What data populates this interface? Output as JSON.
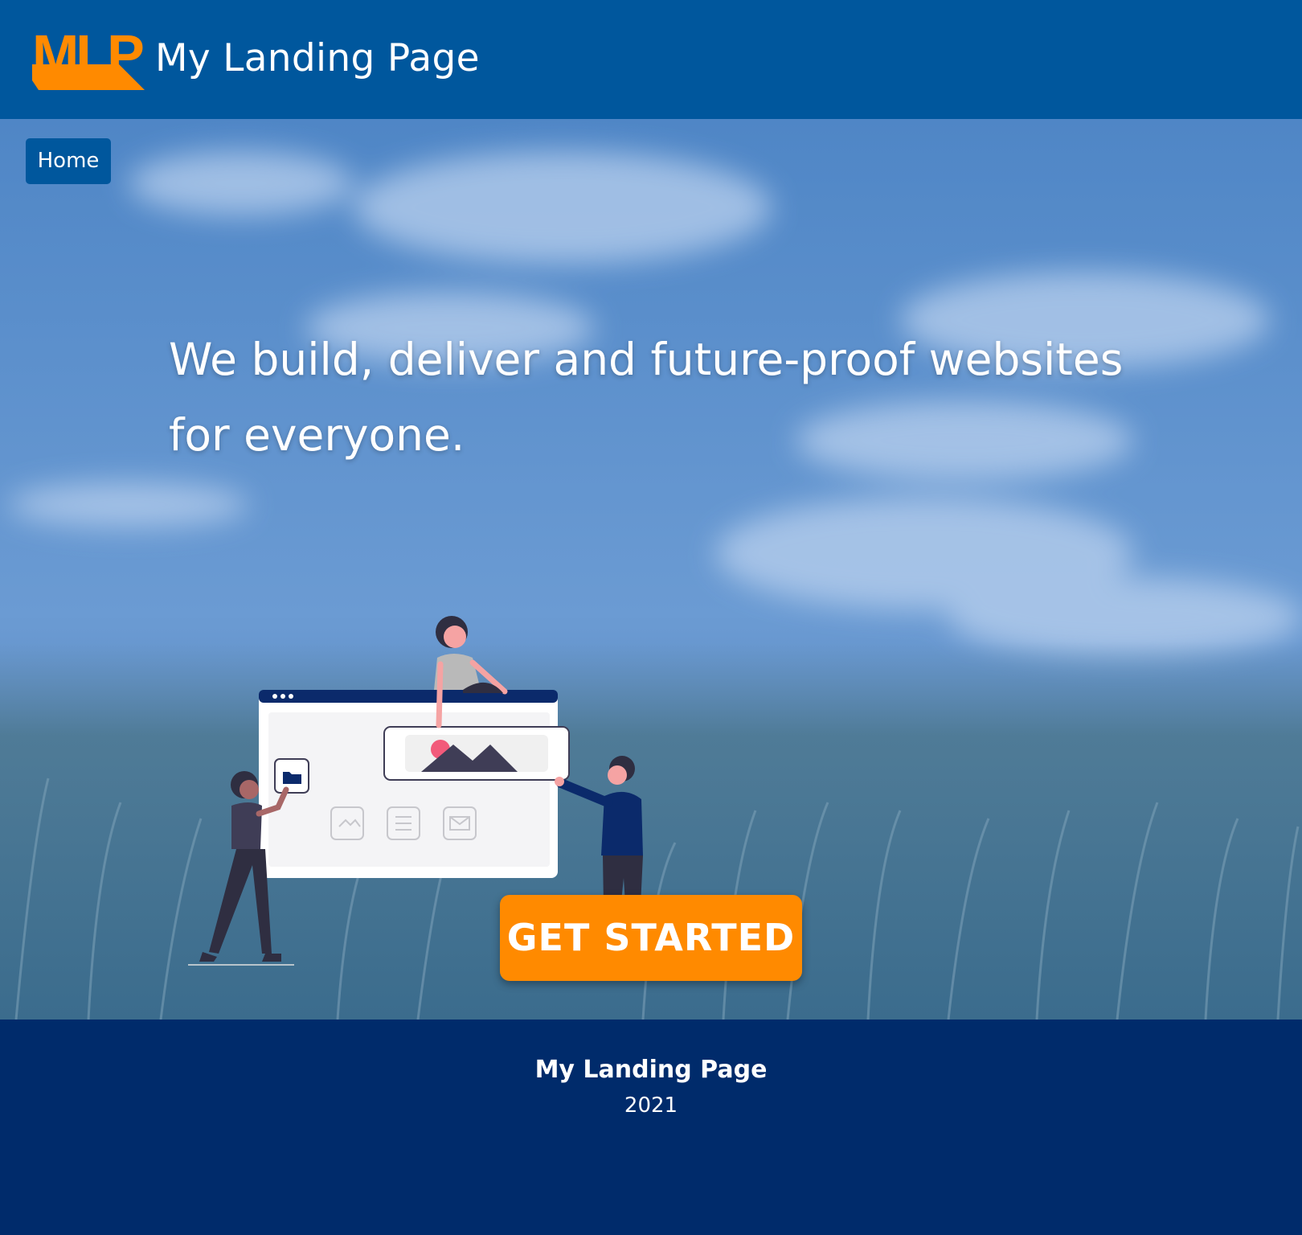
{
  "header": {
    "logo_text": "MLP",
    "title": "My Landing Page"
  },
  "nav": {
    "home_label": "Home"
  },
  "hero": {
    "headline": "We build, deliver and future-proof websites for everyone.",
    "cta_label": "GET STARTED"
  },
  "footer": {
    "title": "My Landing Page",
    "year": "2021"
  },
  "colors": {
    "header_bg": "#00579d",
    "footer_bg": "#002b6b",
    "accent": "#ff8a00",
    "text": "#ffffff"
  }
}
